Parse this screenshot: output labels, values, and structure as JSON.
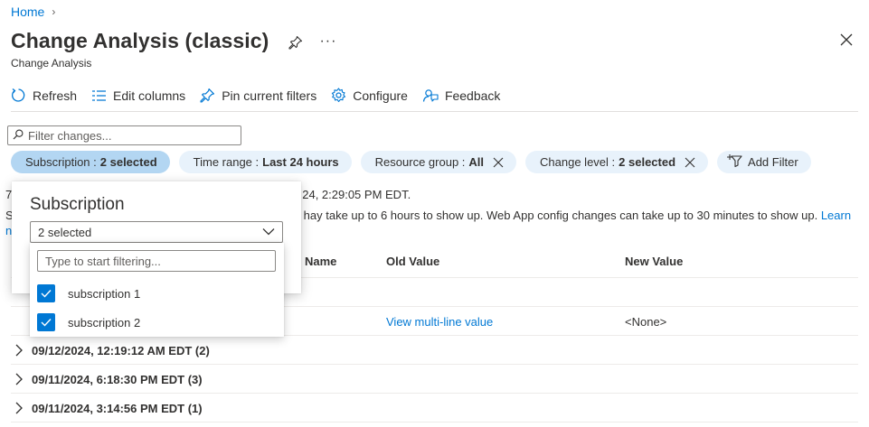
{
  "breadcrumb": {
    "home": "Home",
    "separator": "›"
  },
  "header": {
    "title": "Change Analysis (classic)",
    "subtitle": "Change Analysis",
    "more": "···"
  },
  "toolbar": {
    "refresh": "Refresh",
    "edit_columns": "Edit columns",
    "pin_filters": "Pin current filters",
    "configure": "Configure",
    "feedback": "Feedback"
  },
  "filter": {
    "placeholder": "Filter changes..."
  },
  "pills": {
    "subscription": {
      "label": "Subscription :",
      "value": "2 selected"
    },
    "time_range": {
      "label": "Time range :",
      "value": "Last 24 hours"
    },
    "resource_group": {
      "label": "Resource group :",
      "value": "All"
    },
    "change_level": {
      "label": "Change level :",
      "value": "2 selected"
    },
    "add_filter": "Add Filter"
  },
  "info": {
    "line1_prefix": "7",
    "line1": "24, 2:29:05 PM EDT.",
    "line2_prefix": "S",
    "line2": "hay take up to 6 hours to show up. Web App config changes can take up to 30 minutes to show up.",
    "learn": "Learn",
    "line3_prefix": "n"
  },
  "table": {
    "columns": {
      "name": "Name",
      "old_value": "Old Value",
      "new_value": "New Value"
    },
    "row": {
      "old_value": "View multi-line value",
      "new_value": "<None>"
    },
    "groups": [
      "09/12/2024, 12:19:12 AM EDT (2)",
      "09/11/2024, 6:18:30 PM EDT (3)",
      "09/11/2024, 3:14:56 PM EDT (1)"
    ]
  },
  "popup": {
    "title": "Subscription",
    "selected": "2 selected",
    "search_placeholder": "Type to start filtering...",
    "options": [
      {
        "label": "subscription 1",
        "checked": true
      },
      {
        "label": "subscription 2",
        "checked": true
      }
    ]
  },
  "colors": {
    "accent": "#0078d4",
    "pill": "#e8f2fb",
    "pill_active": "#b3d6f2"
  }
}
